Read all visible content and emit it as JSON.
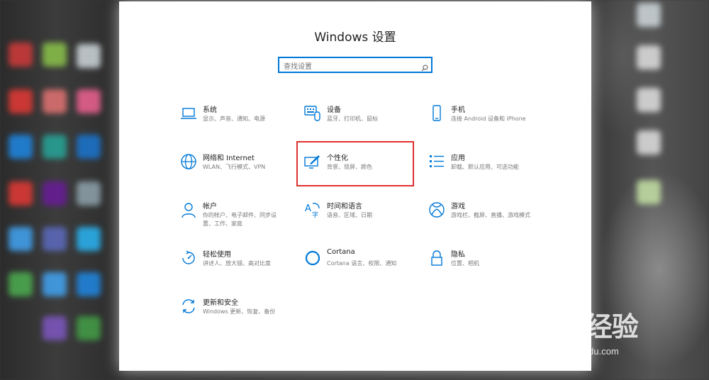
{
  "window": {
    "title": "Windows 设置",
    "search_placeholder": "查找设置"
  },
  "accent": "#0078d7",
  "highlight_color": "#e03030",
  "tiles": [
    {
      "name": "系统",
      "desc": "显示、声音、通知、电源",
      "icon": "laptop-icon"
    },
    {
      "name": "设备",
      "desc": "蓝牙、打印机、鼠标",
      "icon": "keyboard-icon"
    },
    {
      "name": "手机",
      "desc": "连接 Android 设备和 iPhone",
      "icon": "phone-icon"
    },
    {
      "name": "网络和 Internet",
      "desc": "WLAN、飞行模式、VPN",
      "icon": "globe-icon"
    },
    {
      "name": "个性化",
      "desc": "背景、锁屏、颜色",
      "icon": "brush-icon"
    },
    {
      "name": "应用",
      "desc": "卸载、默认应用、可选功能",
      "icon": "apps-list-icon"
    },
    {
      "name": "帐户",
      "desc": "你的帐户、电子邮件、同步设置、工作、家庭",
      "icon": "person-icon"
    },
    {
      "name": "时间和语言",
      "desc": "语音、区域、日期",
      "icon": "time-language-icon"
    },
    {
      "name": "游戏",
      "desc": "游戏栏、截屏、直播、游戏模式",
      "icon": "xbox-icon"
    },
    {
      "name": "轻松使用",
      "desc": "讲述人、放大镜、高对比度",
      "icon": "ease-of-access-icon"
    },
    {
      "name": "Cortana",
      "desc": "Cortana 语言、权限、通知",
      "icon": "cortana-icon"
    },
    {
      "name": "隐私",
      "desc": "位置、相机",
      "icon": "lock-icon"
    },
    {
      "name": "更新和安全",
      "desc": "Windows 更新、恢复、备份",
      "icon": "update-icon"
    }
  ],
  "watermark": {
    "logo": "Bai 经验",
    "url": "jingyan.baidu.com"
  }
}
